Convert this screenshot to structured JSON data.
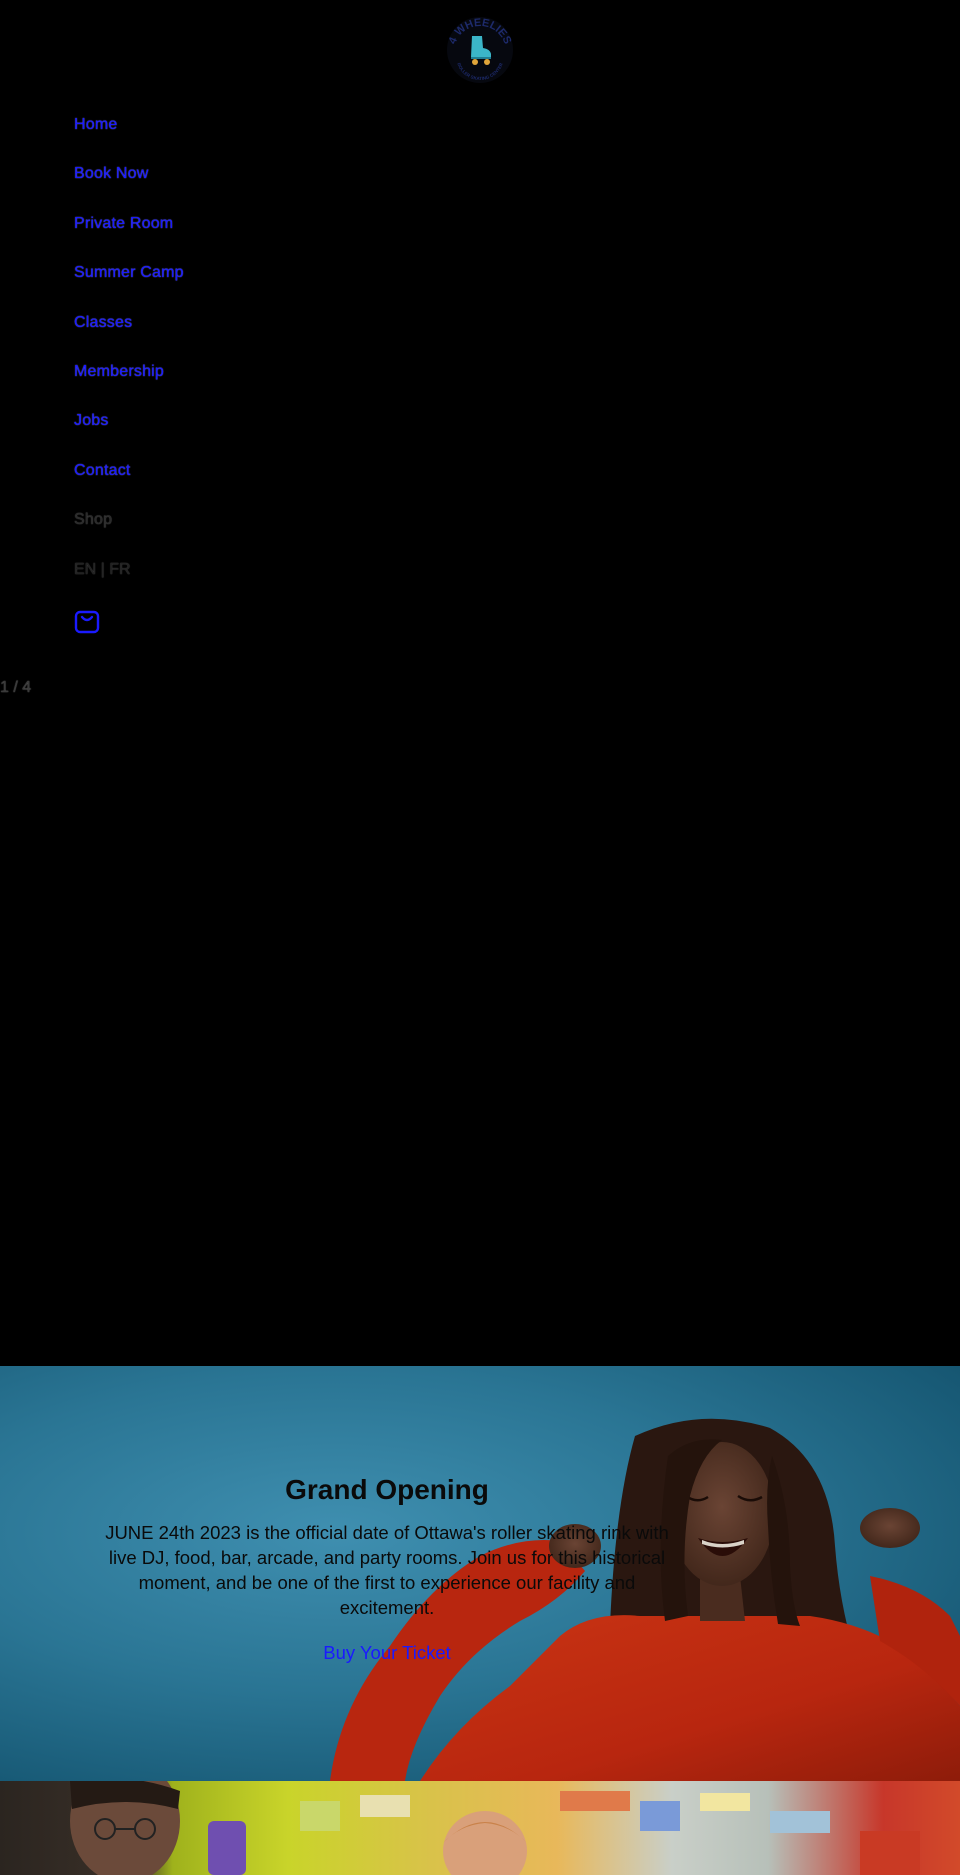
{
  "brand": {
    "logo_text_top": "4 WHEELIES",
    "logo_text_bottom": "ROLLER SKATING CENTER"
  },
  "nav": {
    "items": [
      {
        "label": "Home"
      },
      {
        "label": "Book Now"
      },
      {
        "label": "Private Room"
      },
      {
        "label": "Summer Camp"
      },
      {
        "label": "Classes"
      },
      {
        "label": "Membership"
      },
      {
        "label": "Jobs"
      },
      {
        "label": "Contact"
      },
      {
        "label": "Shop"
      }
    ],
    "language": "EN | FR"
  },
  "slideshow": {
    "counter": "1 / 4"
  },
  "hero": {
    "title": "Grand Opening",
    "text": "JUNE 24th 2023 is the official date of Ottawa's roller skating rink with live DJ, food, bar, arcade, and party rooms. Join us for this historical moment, and be one of the first to experience our facility and excitement.",
    "button_label": "Buy Your Ticket"
  },
  "colors": {
    "link": "#1a1aff",
    "background": "#000000",
    "hero_bg": "#2a7594",
    "sweater": "#b8260f"
  }
}
